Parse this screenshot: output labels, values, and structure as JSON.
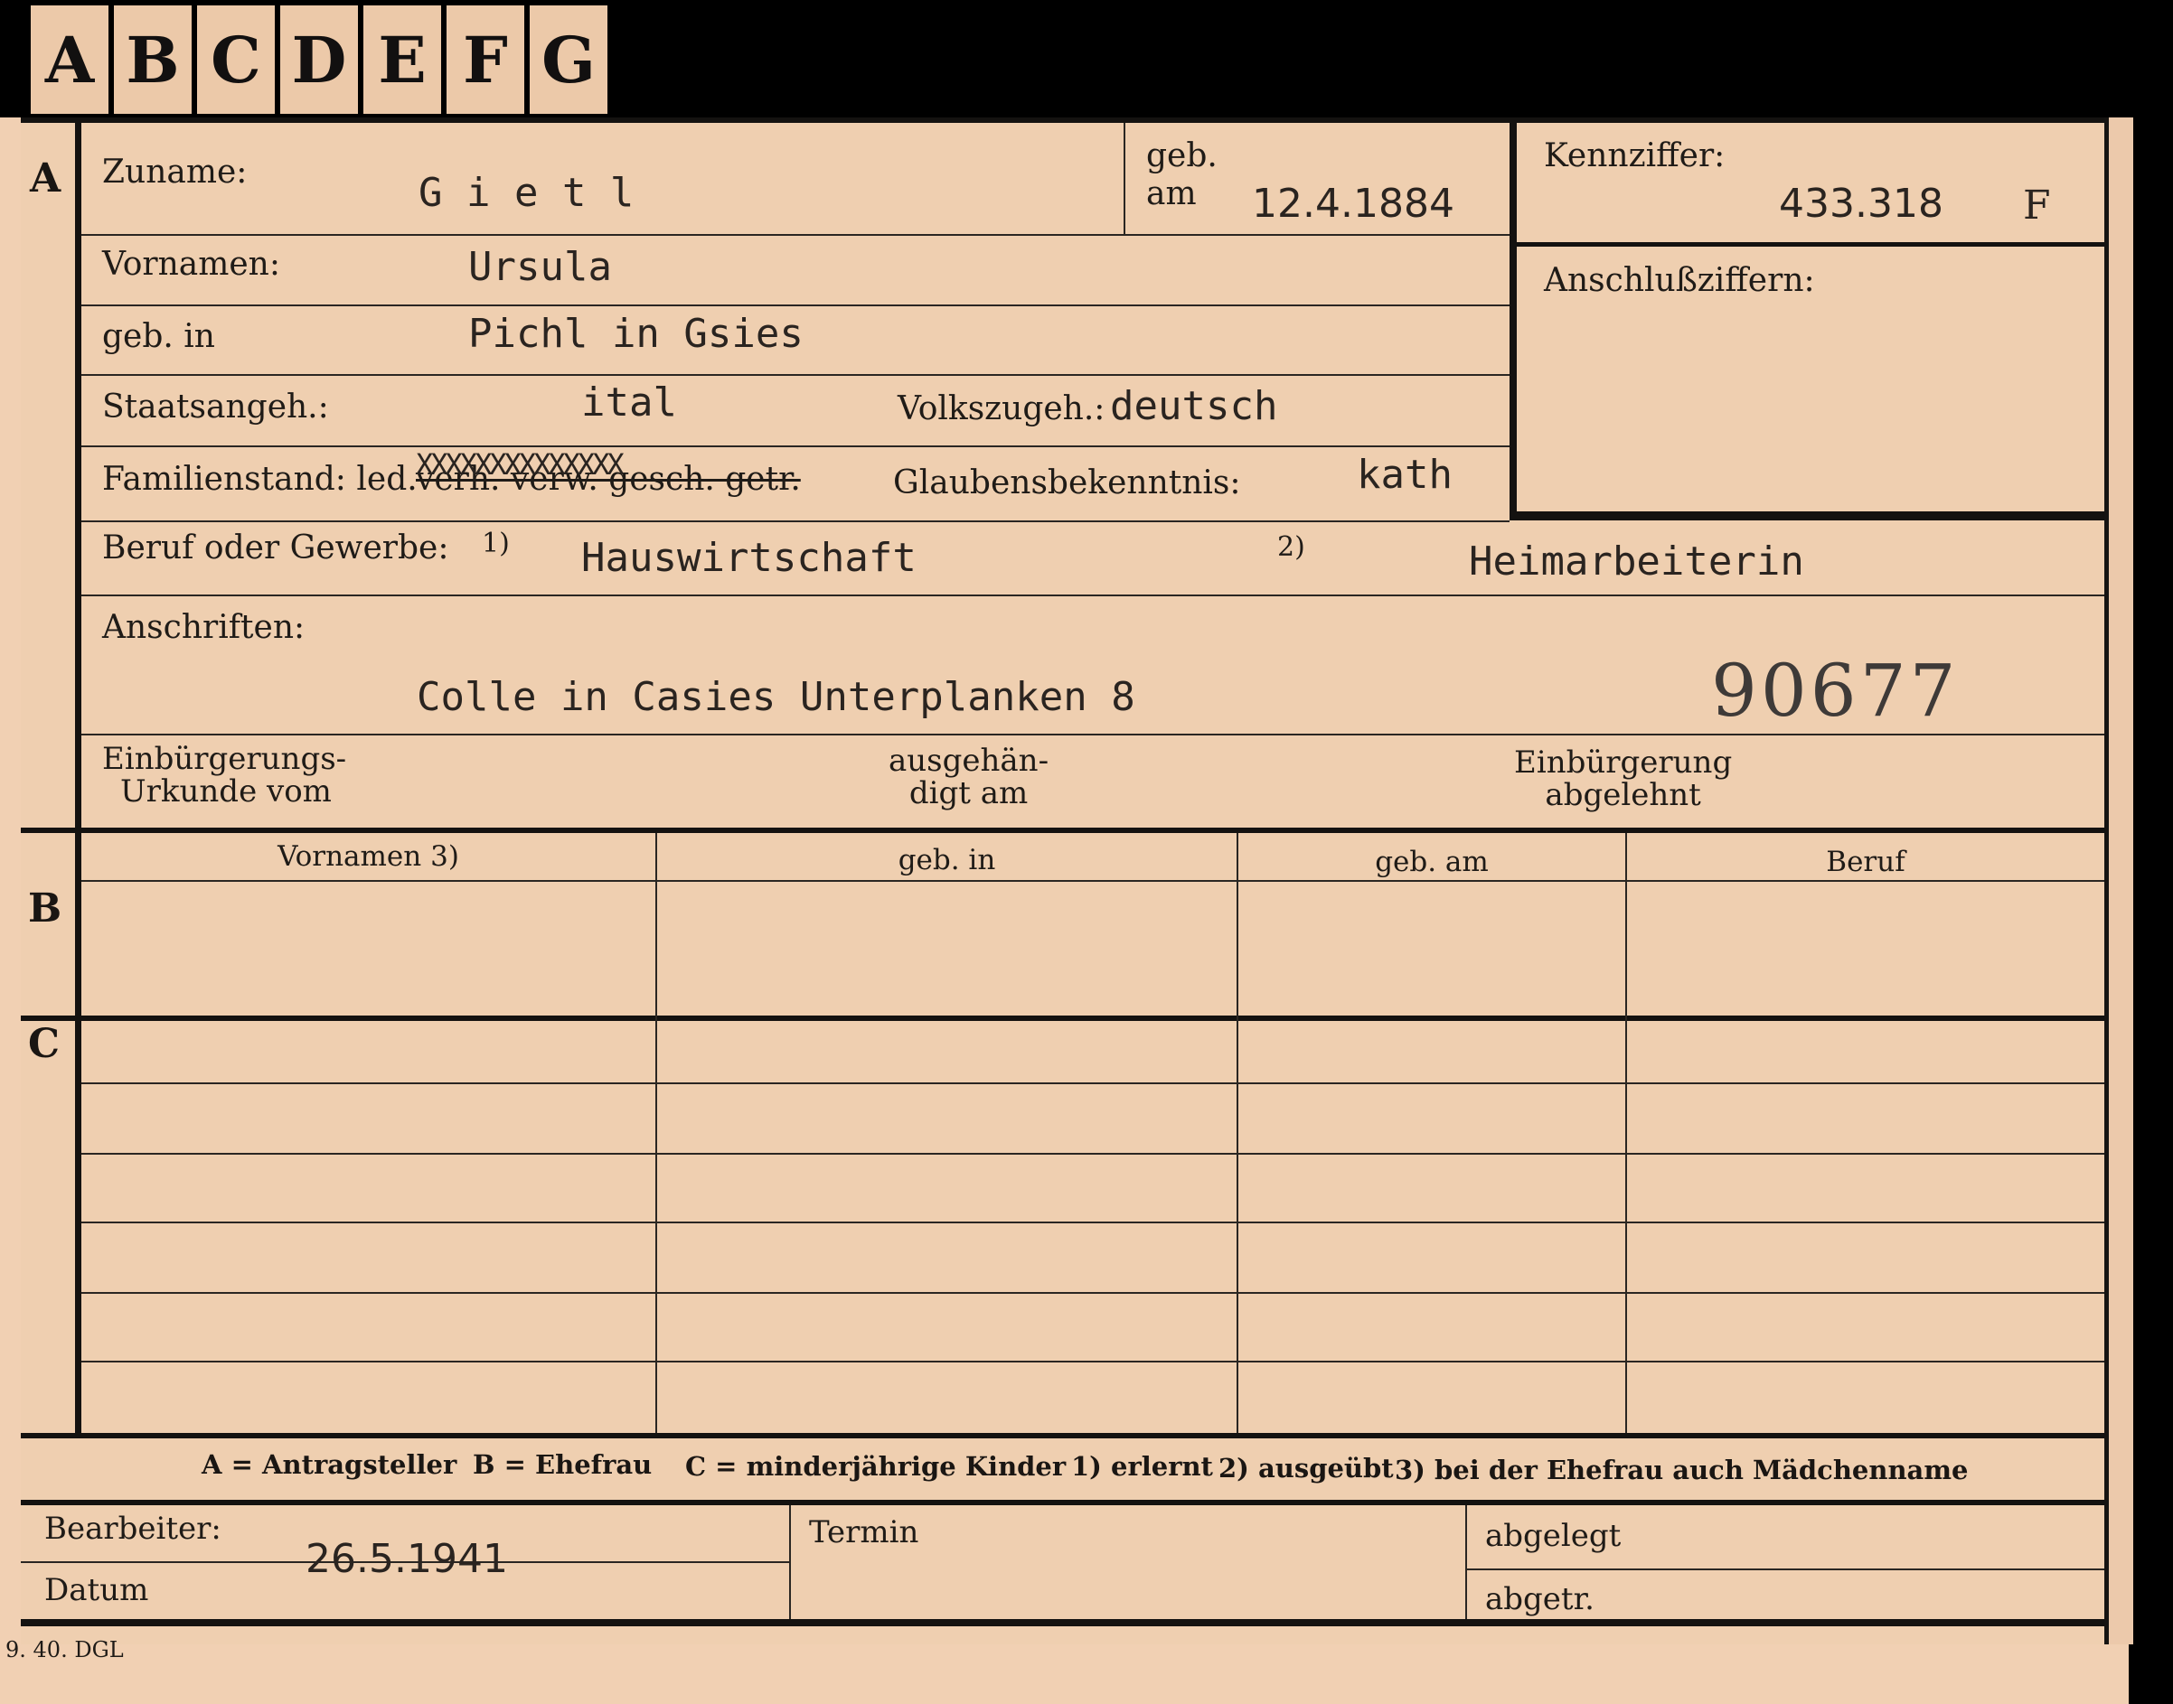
{
  "tabs": [
    "A",
    "B",
    "C",
    "D",
    "E",
    "F",
    "G"
  ],
  "sections": {
    "a": "A",
    "b": "B",
    "c": "C"
  },
  "labels": {
    "zuname": "Zuname:",
    "geb": "geb.",
    "am": "am",
    "kennziffer": "Kennziffer:",
    "vornamen": "Vornamen:",
    "anschlussziffern": "Anschlußziffern:",
    "geb_in": "geb. in",
    "staatsangeh": "Staatsangeh.:",
    "volkszugeh": "Volkszugeh.:",
    "familienstand": "Familienstand: led.",
    "familienstand_struck": "verh. verw. gesch. getr.",
    "glaubensbekenntnis": "Glaubensbekenntnis:",
    "beruf": "Beruf oder Gewerbe:",
    "beruf_note1": "1)",
    "beruf_note2": "2)",
    "anschriften": "Anschriften:",
    "einbuergerung_urkunde_1": "Einbürgerungs-",
    "einbuergerung_urkunde_2": "Urkunde vom",
    "ausgehaendigt_1": "ausgehän-",
    "ausgehaendigt_2": "digt am",
    "einbuergerung_abgelehnt_1": "Einbürgerung",
    "einbuergerung_abgelehnt_2": "abgelehnt",
    "bearbeiter": "Bearbeiter:",
    "datum": "Datum",
    "termin": "Termin",
    "abgelegt": "abgelegt",
    "abgetr": "abgetr."
  },
  "values": {
    "zuname": "G i e t l",
    "geb_am": "12.4.1884",
    "kennziffer": "433.318",
    "kennziffer_suffix": "F",
    "vornamen": "Ursula",
    "geb_in": "Pichl in Gsies",
    "staatsangeh": "ital",
    "volkszugeh": "deutsch",
    "familienstand_overstrike": "XXXXXXXXXXXXXX",
    "glaubensbekenntnis": "kath",
    "beruf_1": "Hauswirtschaft",
    "beruf_2": "Heimarbeiterin",
    "anschrift": "Colle in Casies Unterplanken 8",
    "stamp_number": "90677",
    "bearbeiter_datum": "26.5.1941"
  },
  "table": {
    "headers": [
      "Vornamen 3)",
      "geb. in",
      "geb. am",
      "Beruf"
    ]
  },
  "legend": [
    "A = Antragsteller",
    "B = Ehefrau",
    "C = minderjährige Kinder",
    "1) erlernt",
    "2) ausgeübt",
    "3) bei der Ehefrau auch Mädchenname"
  ],
  "footer_code": "9. 40. DGL"
}
